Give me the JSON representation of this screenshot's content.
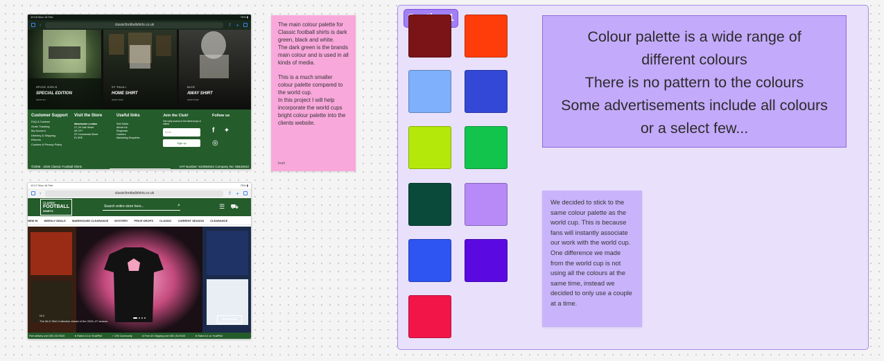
{
  "ipad1": {
    "status_time": "10:18  Mon 16 Feb",
    "status_battery": "75% ▮",
    "url": "classicfootballshirts.co.uk",
    "cards": [
      {
        "kicker": "SPICE GIRLS",
        "title": "SPECIAL EDITION",
        "sub": "SHOP ALL"
      },
      {
        "kicker": "ST PAULI",
        "title": "HOME SHIRT",
        "sub": "SHOP NOW"
      },
      {
        "kicker": "NICE",
        "title": "AWAY SHIRT",
        "sub": "SHOP NOW"
      }
    ],
    "footer": {
      "customer_support": "Customer Support",
      "support_links": [
        "FAQ & Contact",
        "Order Tracking",
        "My Account",
        "Delivery & Shipping",
        "Returns",
        "Cookies & Privacy Policy"
      ],
      "visit_store": "Visit the Store",
      "store_address": [
        "Manchester London",
        "27–29 Cale Street",
        "AR 1FY",
        "ST Commercial Street",
        "E1 6RE"
      ],
      "useful_links": "Useful links",
      "useful_items": [
        "Sell Shirts",
        "About Us",
        "Requests",
        "Careers",
        "Marketing Enquiries"
      ],
      "join_club": "Join the Club!",
      "join_text": "Get early access to the latest drops & offers!",
      "email_placeholder": "Email",
      "sign_up": "Sign up",
      "follow_us": "Follow us",
      "copyright": "©2006 - 2026 Classic Football Shirts",
      "vat": "VAT Number: 910584642 Company No: 05843042"
    }
  },
  "ipad2": {
    "status_time": "10:17  Mon 16 Feb",
    "status_battery": "75% ▮",
    "url": "classicfootballshirts.co.uk",
    "logo_line1": "CLASSIC",
    "logo_line2": "FOOTBALL",
    "logo_line3": "SHIRTS",
    "search_placeholder": "Search entire store here...",
    "nav": [
      "NEW IN",
      "WEEKLY DEALS",
      "WAREHOUSE CLEARANCE",
      "MYSTERY",
      "PRICE DROPS",
      "CLASSIC",
      "CURRENT SEASON",
      "CLEARANCE"
    ],
    "hero_kicker": "MLS",
    "hero_caption": "The MLS Shirt Collection ahead of the 2026–27 season.",
    "shop_now": "SHOP NOW",
    "ticker": [
      "Free delivery over £50 | EU €100",
      "★ Rated 4.4 on TrustPilot",
      "✓ 10% Community",
      "⊘ Free UK Shipping over £50 | EU €100",
      "★ Rated 4.4 on TrustPilot"
    ]
  },
  "sticky_pink": {
    "text": "The main colour palette for Classic football shirts is dark green, black and white.\nThe dark green is the brands main colour and is used in all kinds of media.\n\nThis is a much smaller colour palette compared to the world cup.\nIn this project I will help incorporate the world cups bright colour palette into the clients website.",
    "author": "leah"
  },
  "section": {
    "label": "Section 1",
    "big_note": "Colour palette is a wide range of\ndifferent colours\nThere is no pattern to the colours\nSome advertisements include all colours\nor a select few...",
    "small_note": "We decided to stick to the same colour palette as the world cup. This is because fans will instantly associate our work with the world cup.\nOne difference we made from the world cup is not using all the colours at the same time, instead we decided to only use a couple at a time.",
    "swatches": [
      "#7b1417",
      "#ff3d0a",
      "#7eb0fb",
      "#3348d6",
      "#b4e80a",
      "#12c44c",
      "#0a4a3a",
      "#b78af7",
      "#2e54f1",
      "#5a0ae0",
      "#f21648"
    ]
  }
}
